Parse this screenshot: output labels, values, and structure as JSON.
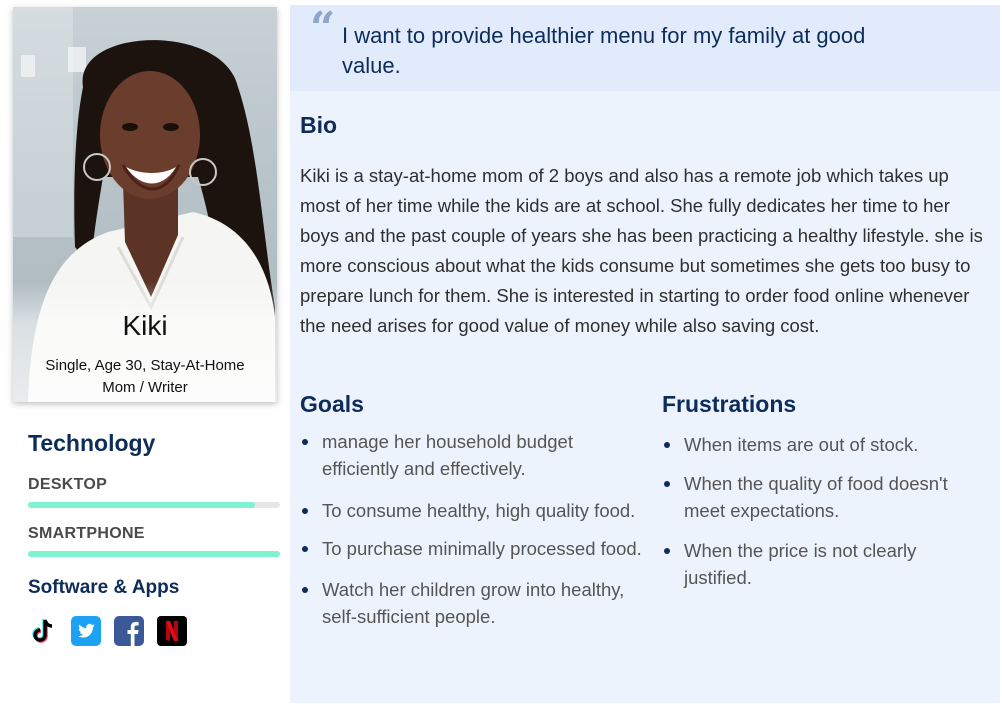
{
  "persona": {
    "name": "Kiki",
    "info": "Single, Age 30, Stay-At-Home Mom / Writer"
  },
  "technology": {
    "heading": "Technology",
    "skills": [
      {
        "label": "DESKTOP",
        "level": 0.9
      },
      {
        "label": "SMARTPHONE",
        "level": 1.0
      }
    ],
    "accent_color": "#7ff2cf"
  },
  "apps": {
    "heading": "Software & Apps",
    "icons": [
      "tiktok-icon",
      "twitter-icon",
      "facebook-icon",
      "netflix-icon"
    ]
  },
  "quote": {
    "text": "I want to provide healthier menu for my family at good value."
  },
  "bio": {
    "heading": "Bio",
    "text": "Kiki is a stay-at-home mom of 2 boys and also has a remote job which takes up most of her time while the kids are at school. She fully dedicates her time to her boys and the past couple of years she has been practicing a healthy lifestyle. she is more conscious about what the kids consume but sometimes she gets too busy to prepare lunch for them. She is interested in starting to order food online whenever the need arises for good value of money while also saving cost."
  },
  "goals": {
    "heading": "Goals",
    "items": [
      "manage her household budget efficiently and effectively.",
      "To consume healthy, high quality food.",
      "To purchase minimally processed food.",
      "Watch her children grow into healthy, self-sufficient people."
    ]
  },
  "frustrations": {
    "heading": "Frustrations",
    "items": [
      "When items are out of stock.",
      "When the quality of food doesn't meet expectations.",
      "When the price is not clearly justified."
    ]
  },
  "colors": {
    "heading": "#0d2c5a",
    "quote_bg": "#e1ebfb",
    "content_bg": "#edf3fd"
  }
}
